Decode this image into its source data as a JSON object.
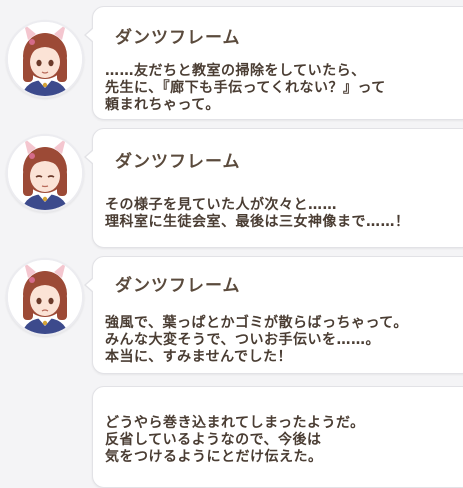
{
  "messages": [
    {
      "speaker": "ダンツフレーム",
      "text": "……友だちと教室の掃除をしていたら、\n先生に、『廊下も手伝ってくれない？』って\n頼まれちゃって。",
      "avatar_icon": "character-portrait-icon"
    },
    {
      "speaker": "ダンツフレーム",
      "text": "その様子を見ていた人が次々と……\n理科室に生徒会室、最後は三女神像まで……！",
      "avatar_icon": "character-portrait-icon"
    },
    {
      "speaker": "ダンツフレーム",
      "text": "強風で、葉っぱとかゴミが散らばっちゃって。\nみんな大変そうで、ついお手伝いを……。\n本当に、すみませんでした！",
      "avatar_icon": "character-portrait-icon"
    },
    {
      "speaker": "",
      "text": "どうやら巻き込まれてしまったようだ。\n反省しているようなので、今後は\n気をつけるようにとだけ伝えた。"
    }
  ],
  "colors": {
    "background": "#f4f4f6",
    "bubble": "#ffffff",
    "text": "#4a3d33",
    "hair": "#9c4a36",
    "ribbon": "#d46b8a",
    "uniform": "#3c4a8c"
  }
}
